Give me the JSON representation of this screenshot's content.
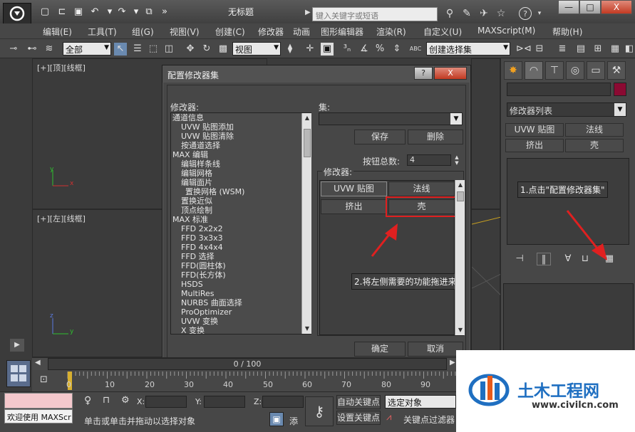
{
  "window": {
    "title": "无标题",
    "search_placeholder": "键入关键字或短语",
    "minimize": "—",
    "maximize": "□",
    "close": "X",
    "help": "?"
  },
  "menu": [
    "编辑(E)",
    "工具(T)",
    "组(G)",
    "视图(V)",
    "创建(C)",
    "修改器",
    "动画",
    "图形编辑器",
    "渲染(R)",
    "自定义(U)",
    "MAXScript(M)",
    "帮助(H)"
  ],
  "toolbar": {
    "filter": "全部",
    "coord": "视图",
    "selection_set": "创建选择集",
    "abc_label": "ABC"
  },
  "viewports": {
    "top": "[+][顶][线框]",
    "left": "[+][左][线框]",
    "axis_x": "x",
    "axis_y": "y",
    "axis_z": "z"
  },
  "dialog": {
    "title": "配置修改器集",
    "help_btn": "?",
    "close_btn": "X",
    "modifiers_label": "修改器:",
    "set_label": "集:",
    "save": "保存",
    "delete": "删除",
    "button_total_label": "按钮总数:",
    "button_total": "4",
    "group_label": "修改器:",
    "buttons": [
      "UVW 贴图",
      "法线",
      "挤出",
      "壳"
    ],
    "ok": "确定",
    "cancel": "取消",
    "list": [
      {
        "text": "通道信息",
        "level": 0
      },
      {
        "text": "UVW 贴图添加",
        "level": 1
      },
      {
        "text": "UVW 贴图清除",
        "level": 1
      },
      {
        "text": "按通道选择",
        "level": 1
      },
      {
        "text": "MAX 编辑",
        "level": 0
      },
      {
        "text": "编辑样条线",
        "level": 1
      },
      {
        "text": "编辑网格",
        "level": 1
      },
      {
        "text": "编辑面片",
        "level": 1
      },
      {
        "text": "置换网格 (WSM)",
        "level": 2
      },
      {
        "text": "置换近似",
        "level": 1
      },
      {
        "text": "顶点绘制",
        "level": 1
      },
      {
        "text": "MAX 标准",
        "level": 0
      },
      {
        "text": "FFD 2x2x2",
        "level": 1
      },
      {
        "text": "FFD 3x3x3",
        "level": 1
      },
      {
        "text": "FFD 4x4x4",
        "level": 1
      },
      {
        "text": "FFD 选择",
        "level": 1
      },
      {
        "text": "FFD(圆柱体)",
        "level": 1
      },
      {
        "text": "FFD(长方体)",
        "level": 1
      },
      {
        "text": "HSDS",
        "level": 1
      },
      {
        "text": "MultiRes",
        "level": 1
      },
      {
        "text": "NURBS 曲面选择",
        "level": 1
      },
      {
        "text": "ProOptimizer",
        "level": 1
      },
      {
        "text": "UVW 变换",
        "level": 1
      },
      {
        "text": "X 变换",
        "level": 1
      }
    ]
  },
  "annotations": {
    "step1": "1.点击\"配置修改器集\"",
    "step2": "2.将左侧需要的功能拖进来"
  },
  "command_panel": {
    "modifier_list": "修改器列表",
    "buttons": [
      "UVW 贴图",
      "法线",
      "挤出",
      "壳"
    ]
  },
  "timeline": {
    "frame": "0 / 100",
    "ticks": [
      "0",
      "10",
      "20",
      "30",
      "40",
      "50",
      "60",
      "70",
      "80",
      "90"
    ]
  },
  "status": {
    "welcome": "欢迎使用 MAXScr",
    "hint": "单击或单击并拖动以选择对象",
    "x_label": "X:",
    "y_label": "Y:",
    "z_label": "Z:",
    "add": "添",
    "auto_key": "自动关键点",
    "set_key": "设置关键点",
    "selected": "选定对象",
    "key_filter": "关键点过滤器"
  },
  "watermark": {
    "title": "土木工程网",
    "url": "www.civilcn.com"
  },
  "colors": {
    "accent_red": "#e02020",
    "object_color": "#8b0a32",
    "watermark_blue": "#1f6fc1"
  }
}
